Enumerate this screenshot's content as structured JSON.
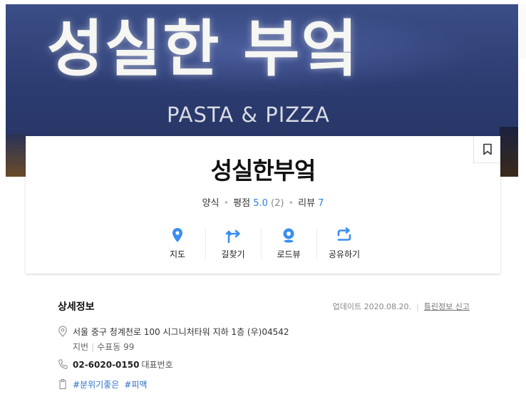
{
  "hero": {
    "sign_korean": "성실한 부엌",
    "sign_english": "PASTA & PIZZA"
  },
  "place": {
    "name": "성실한부엌",
    "category": "양식",
    "rating_label": "평점",
    "rating_value": "5.0",
    "rating_count": "(2)",
    "review_label": "리뷰",
    "review_count": "7"
  },
  "actions": [
    {
      "label": "지도",
      "icon": "map-pin-icon"
    },
    {
      "label": "길찾기",
      "icon": "directions-icon"
    },
    {
      "label": "로드뷰",
      "icon": "roadview-icon"
    },
    {
      "label": "공유하기",
      "icon": "share-icon"
    }
  ],
  "detail": {
    "title": "상세정보",
    "updated": "업데이트 2020.08.20.",
    "report": "틀린정보 신고",
    "address": "서울 중구 청계천로 100 시그니처타워 지하 1층 (우)04542",
    "jibun_label": "지번",
    "jibun_value": "수표동 99",
    "phone": "02-6020-0150",
    "phone_label": "대표번호",
    "tags": [
      "#분위기좋은",
      "#피맥"
    ]
  },
  "colors": {
    "accent_blue": "#2a7fe3",
    "icon_blue": "#3a8ef0",
    "hero_bg": "#2d3d72"
  }
}
